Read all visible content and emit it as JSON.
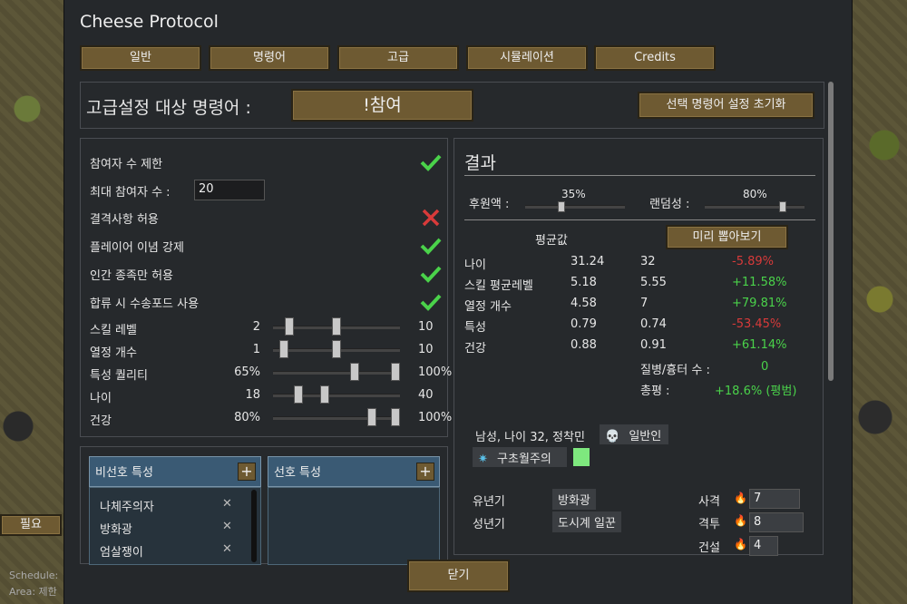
{
  "background": {
    "need_label": "필요",
    "schedule_label": "Schedule:",
    "area_label": "Area: 제한"
  },
  "window": {
    "title": "Cheese Protocol",
    "tabs": [
      {
        "label": "일반"
      },
      {
        "label": "명령어"
      },
      {
        "label": "고급"
      },
      {
        "label": "시뮬레이션"
      },
      {
        "label": "Credits"
      }
    ],
    "command_label": "고급설정 대상 명령어 :",
    "command_value": "!참여",
    "reset_button": "선택 명령어 설정 초기화",
    "close_button": "닫기"
  },
  "settings": {
    "toggles": [
      {
        "label": "참여자 수 제한",
        "checked": true
      },
      {
        "label": "결격사항 허용",
        "checked": false
      },
      {
        "label": "플레이어 이념 강제",
        "checked": true
      },
      {
        "label": "인간 종족만 허용",
        "checked": true
      },
      {
        "label": "합류 시 수송포드 사용",
        "checked": true
      }
    ],
    "max_participants_label": "최대 참여자 수 :",
    "max_participants_value": "20",
    "ranges": [
      {
        "label": "스킬 레벨",
        "min": "2",
        "max": "10",
        "min_val": 2,
        "max_val": 10,
        "lo": 0,
        "hi": 20
      },
      {
        "label": "열정 개수",
        "min": "1",
        "max": "10",
        "min_val": 1,
        "max_val": 10,
        "lo": 0,
        "hi": 20
      },
      {
        "label": "특성 퀄리티",
        "min": "65%",
        "max": "100%",
        "min_val": 65,
        "max_val": 100,
        "lo": 0,
        "hi": 100
      },
      {
        "label": "나이",
        "min": "18",
        "max": "40",
        "min_val": 18,
        "max_val": 40,
        "lo": 0,
        "hi": 100
      },
      {
        "label": "건강",
        "min": "80%",
        "max": "100%",
        "min_val": 80,
        "max_val": 100,
        "lo": 0,
        "hi": 100
      }
    ]
  },
  "traits": {
    "disliked_header": "비선호 특성",
    "liked_header": "선호 특성",
    "disliked": [
      "나체주의자",
      "방화광",
      "엄살쟁이"
    ]
  },
  "result": {
    "title": "결과",
    "sponsor_label": "후원액 :",
    "sponsor_value": "35%",
    "sponsor_fraction": 0.35,
    "random_label": "랜덤성 :",
    "random_value": "80%",
    "random_fraction": 0.8,
    "avg_header": "평균값",
    "preview_button": "미리 뽑아보기",
    "stats": [
      {
        "label": "나이",
        "avg": "31.24",
        "val": "32",
        "diff": "-5.89%",
        "positive": false
      },
      {
        "label": "스킬 평균레벨",
        "avg": "5.18",
        "val": "5.55",
        "diff": "+11.58%",
        "positive": true
      },
      {
        "label": "열정 개수",
        "avg": "4.58",
        "val": "7",
        "diff": "+79.81%",
        "positive": true
      },
      {
        "label": "특성",
        "avg": "0.79",
        "val": "0.74",
        "diff": "-53.45%",
        "positive": false
      },
      {
        "label": "건강",
        "avg": "0.88",
        "val": "0.91",
        "diff": "+61.14%",
        "positive": true
      }
    ],
    "disease_label": "질병/흉터 수 :",
    "disease_value": "0",
    "total_label": "총평 :",
    "total_value": "+18.6% (평범)",
    "pawn_desc": "남성, 나이 32, 정착민",
    "pawn_type": "일반인",
    "ideology": "구초월주의",
    "ideology_color": "#7ee87e",
    "childhood_label": "유년기",
    "childhood_value": "방화광",
    "adulthood_label": "성년기",
    "adulthood_value": "도시계 일꾼",
    "skills": [
      {
        "label": "사격",
        "value": "7"
      },
      {
        "label": "격투",
        "value": "8"
      },
      {
        "label": "건설",
        "value": "4"
      }
    ]
  }
}
